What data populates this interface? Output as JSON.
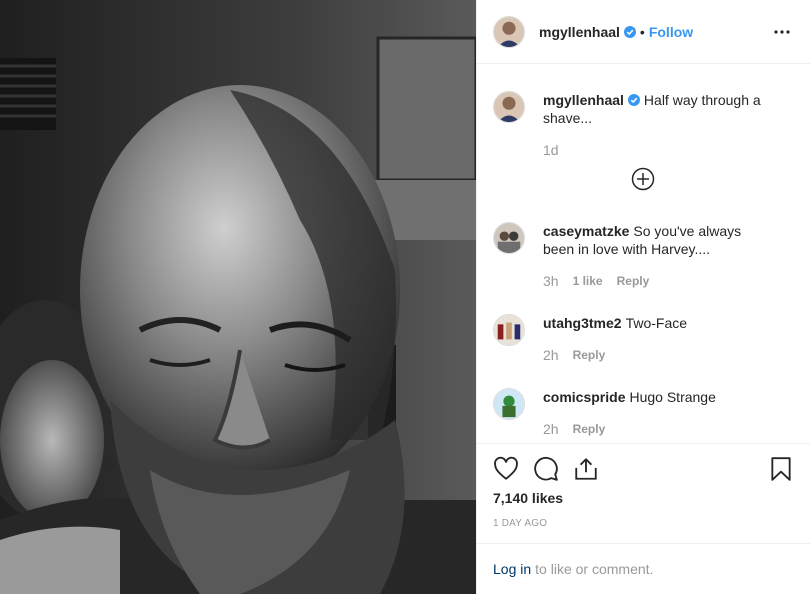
{
  "post": {
    "username": "mgyllenhaal",
    "follow_label": "Follow",
    "dot": "•",
    "caption": "Half way through a shave...",
    "caption_age": "1d"
  },
  "comments": [
    {
      "username": "caseymatzke",
      "text": "So you've always been in love with Harvey....",
      "time": "3h",
      "likes": "1 like",
      "reply": "Reply"
    },
    {
      "username": "utahg3tme2",
      "text": "Two-Face",
      "time": "2h",
      "reply": "Reply"
    },
    {
      "username": "comicspride",
      "text": "Hugo Strange",
      "time": "2h",
      "reply": "Reply"
    }
  ],
  "stats": {
    "likes": "7,140 likes",
    "date": "1 DAY AGO"
  },
  "login": {
    "link": "Log in",
    "rest": "to like or comment."
  },
  "icons": [
    "verified-badge-icon",
    "more-options-icon",
    "load-more-icon",
    "heart-icon",
    "comment-icon",
    "share-icon",
    "bookmark-icon"
  ],
  "colors": {
    "link": "#3897f0",
    "muted": "#999999",
    "text": "#262626",
    "login_link": "#003569"
  }
}
